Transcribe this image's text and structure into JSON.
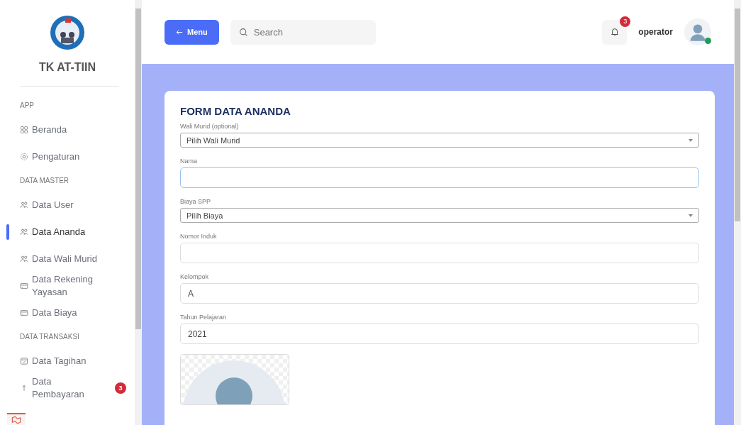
{
  "sidebar": {
    "brand": "TK AT-TIIN",
    "sections": [
      {
        "title": "APP",
        "items": [
          {
            "label": "Beranda",
            "kind": "grid",
            "selected": false
          },
          {
            "label": "Pengaturan",
            "kind": "gear",
            "selected": false
          }
        ]
      },
      {
        "title": "DATA MASTER",
        "items": [
          {
            "label": "Data User",
            "kind": "users",
            "selected": false
          },
          {
            "label": "Data Ananda",
            "kind": "users",
            "selected": true
          },
          {
            "label": "Data Wali Murid",
            "kind": "users",
            "selected": false
          },
          {
            "label": "Data Rekening Yayasan",
            "kind": "card",
            "selected": false
          },
          {
            "label": "Data Biaya",
            "kind": "card",
            "selected": false
          }
        ]
      },
      {
        "title": "DATA TRANSAKSI",
        "items": [
          {
            "label": "Data Tagihan",
            "kind": "calendar",
            "selected": false
          },
          {
            "label": "Data Pembayaran",
            "kind": "upload",
            "selected": false,
            "badge": "3"
          }
        ]
      }
    ]
  },
  "topbar": {
    "menu_button": "Menu",
    "search": {
      "placeholder": "Search"
    },
    "notifications": {
      "count": "3"
    },
    "user": {
      "name": "operator",
      "online": true
    }
  },
  "form": {
    "title": "FORM DATA ANANDA",
    "fields": [
      {
        "kind": "select",
        "label": "Wali Murid (optional)",
        "value": "Pilih Wali Murid"
      },
      {
        "kind": "input",
        "label": "Nama",
        "focused": true
      },
      {
        "kind": "select",
        "label": "Biaya SPP",
        "value": "Pilih Biaya"
      },
      {
        "kind": "input",
        "label": "Nomor Induk",
        "focused": false
      },
      {
        "kind": "input",
        "label": "Kelompok",
        "value": "A",
        "focused": false
      },
      {
        "kind": "input",
        "label": "Tahun Pelajaran",
        "value": "2021",
        "focused": false
      }
    ]
  }
}
